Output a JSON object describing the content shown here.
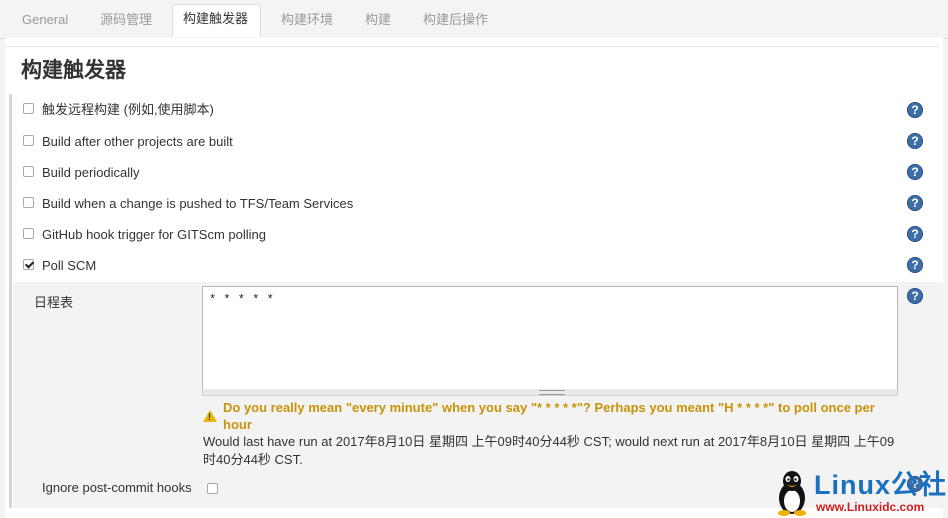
{
  "tabs": [
    {
      "label": "General"
    },
    {
      "label": "源码管理"
    },
    {
      "label": "构建触发器",
      "active": true
    },
    {
      "label": "构建环境"
    },
    {
      "label": "构建"
    },
    {
      "label": "构建后操作"
    }
  ],
  "section": {
    "title": "构建触发器"
  },
  "triggers": [
    {
      "label": "触发远程构建 (例如,使用脚本)",
      "checked": false
    },
    {
      "label": "Build after other projects are built",
      "checked": false
    },
    {
      "label": "Build periodically",
      "checked": false
    },
    {
      "label": "Build when a change is pushed to TFS/Team Services",
      "checked": false
    },
    {
      "label": "GitHub hook trigger for GITScm polling",
      "checked": false
    },
    {
      "label": "Poll SCM",
      "checked": true
    }
  ],
  "poll": {
    "schedule_label": "日程表",
    "schedule_value": "* * * * *",
    "warning": "Do you really mean \"every minute\" when you say \"* * * * *\"? Perhaps you meant \"H * * * *\" to poll once per hour",
    "info": "Would last have run at 2017年8月10日 星期四 上午09时40分44秒 CST; would next run at 2017年8月10日 星期四 上午09时40分44秒 CST.",
    "ignore_label": "Ignore post-commit hooks",
    "ignore_checked": false
  },
  "help_glyph": "?",
  "warning_glyph": "!",
  "icons": {
    "help": "help-icon",
    "warning": "warning-icon"
  },
  "colors": {
    "help": "#3d6ea8",
    "warning_text": "#c8930a",
    "warning_icon": "#e8b70e"
  },
  "watermark": {
    "main": "Linux公社",
    "sub": "www.Linuxidc.com"
  }
}
